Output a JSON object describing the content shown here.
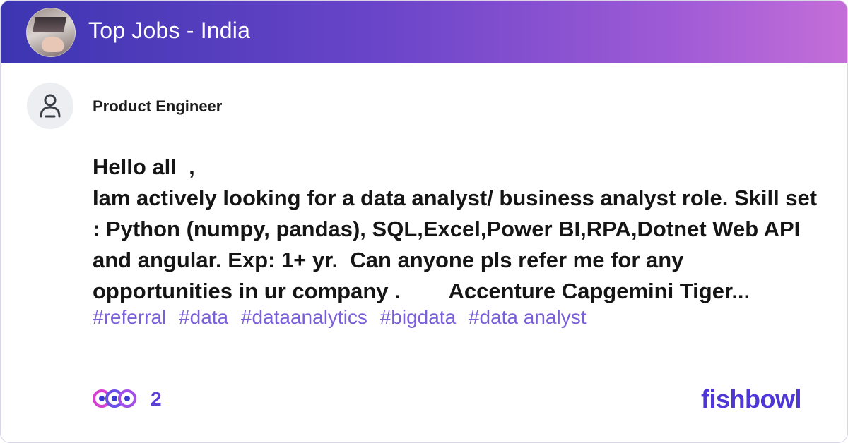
{
  "header": {
    "title": "Top Jobs - India",
    "gradient_start": "#3c35b1",
    "gradient_end": "#c46ed8"
  },
  "author": {
    "role": "Product Engineer",
    "avatar_icon": "person-icon"
  },
  "post": {
    "text": "Hello all  ,\nIam actively looking for a data analyst/ business analyst role. Skill set : Python (numpy, pandas), SQL,Excel,Power BI,RPA,Dotnet Web API and angular. Exp: 1+ yr.  Can anyone pls refer me for any opportunities in ur company .        Accenture Capgemini Tiger..."
  },
  "tags": [
    "#referral",
    "#data",
    "#dataanalytics",
    "#bigdata",
    "#data analyst"
  ],
  "footer": {
    "reaction_count": "2",
    "reaction_icons": [
      "heart-reaction-icon",
      "star-reaction-icon",
      "clap-reaction-icon"
    ],
    "brand": "fishbowl",
    "brand_color": "#4f36d6"
  }
}
